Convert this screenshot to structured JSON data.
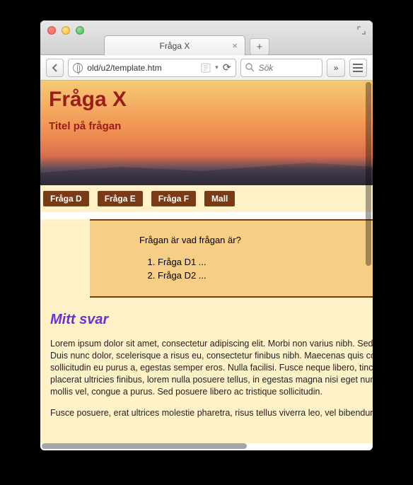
{
  "browser": {
    "tab_title": "Fråga X",
    "url": "old/u2/template.htm",
    "search_placeholder": "Sök"
  },
  "hero": {
    "title": "Fråga X",
    "subtitle": "Titel på frågan"
  },
  "nav": {
    "items": [
      {
        "label": "Fråga D"
      },
      {
        "label": "Fråga E"
      },
      {
        "label": "Fråga F"
      },
      {
        "label": "Mall"
      }
    ]
  },
  "question": {
    "prompt": "Frågan är vad frågan är?",
    "subitems": [
      "Fråga D1 ...",
      "Fråga D2 ..."
    ]
  },
  "answer": {
    "heading": "Mitt svar",
    "para1": "Lorem ipsum dolor sit amet, consectetur adipiscing elit. Morbi non varius nibh. Sed vel tellus tempus, rutrum nibh et, pellentesque. Duis nunc dolor, scelerisque a risus eu, consectetur finibus nibh. Maecenas quis commodo nisl, et aliquet enim. In est ante, sollicitudin eu purus a, egestas semper eros. Nulla facilisi. Fusce neque libero, tincidunt sed odio vitae. Cras eget maximus, urna placerat ultricies finibus, lorem nulla posuere tellus, in egestas magna nisi eget nunc. Mauris porttitor, dui quam lacus, tristique eget mollis vel, congue a purus. Sed posuere libero ac tristique sollicitudin.",
    "para2": "Fusce posuere, erat ultrices molestie pharetra, risus tellus viverra leo, vel bibendum felis diam id velit. Nullam luctus."
  }
}
